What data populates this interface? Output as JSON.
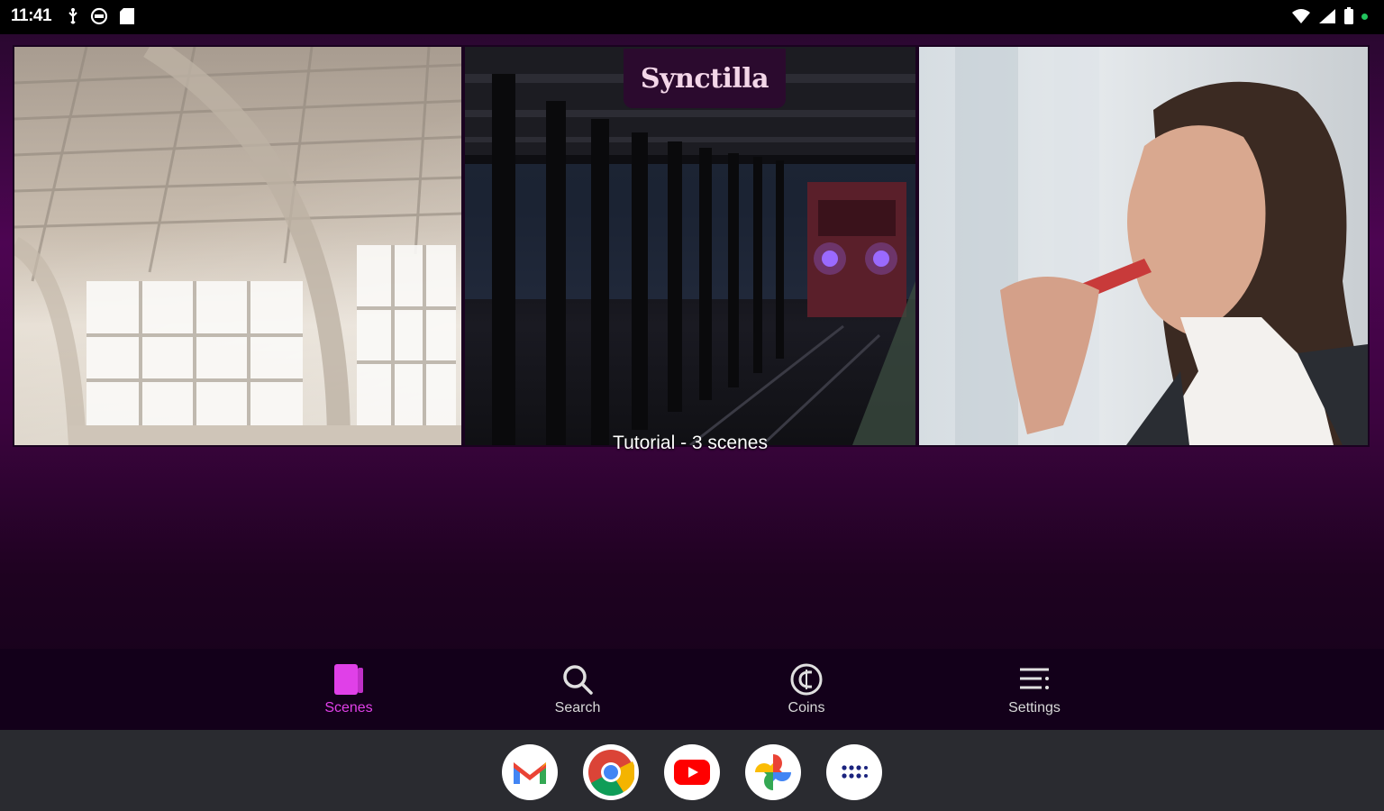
{
  "status_bar": {
    "time": "11:41",
    "left_icons": [
      "usb-icon",
      "vpn-icon",
      "sd-card-icon"
    ],
    "right_icons": [
      "wifi-icon",
      "signal-icon",
      "battery-icon"
    ],
    "indicator_color": "#22c55e"
  },
  "app": {
    "logo": "Synctilla",
    "strip_caption": "Tutorial - 3 scenes",
    "scenes": [
      {
        "thumbnail": "empty-hall-scene"
      },
      {
        "thumbnail": "subway-train-scene"
      },
      {
        "thumbnail": "woman-eating-popsicle-scene"
      }
    ],
    "accent_color": "#e040e8"
  },
  "bottom_nav": {
    "items": [
      {
        "label": "Scenes",
        "icon": "scenes-icon",
        "active": true
      },
      {
        "label": "Search",
        "icon": "search-icon",
        "active": false
      },
      {
        "label": "Coins",
        "icon": "coins-icon",
        "active": false
      },
      {
        "label": "Settings",
        "icon": "settings-icon",
        "active": false
      }
    ]
  },
  "taskbar": {
    "apps": [
      {
        "name": "Gmail",
        "icon": "gmail-icon"
      },
      {
        "name": "Chrome",
        "icon": "chrome-icon"
      },
      {
        "name": "YouTube",
        "icon": "youtube-icon"
      },
      {
        "name": "Photos",
        "icon": "photos-icon"
      },
      {
        "name": "All apps",
        "icon": "app-drawer-icon"
      }
    ]
  }
}
